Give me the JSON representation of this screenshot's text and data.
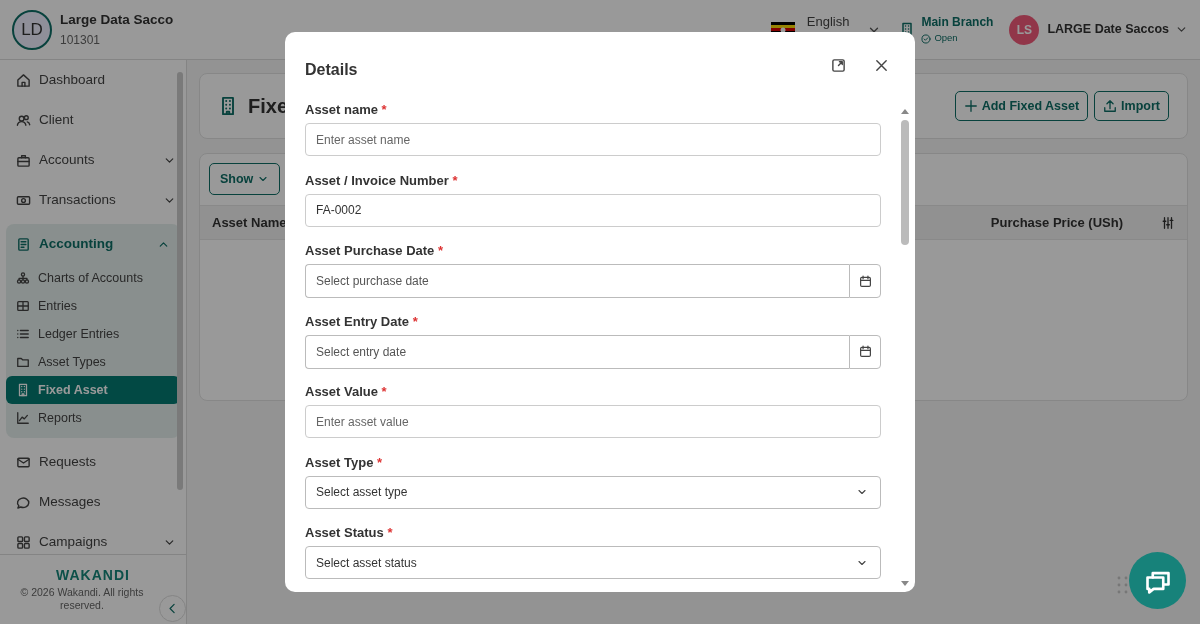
{
  "header": {
    "org": {
      "initials": "LD",
      "name": "Large Data Sacco",
      "code": "101301"
    },
    "language": "English",
    "branch": {
      "name": "Main Branch",
      "status": "Open"
    },
    "user": {
      "initials": "LS",
      "name": "LARGE Date Saccos"
    }
  },
  "sidebar": {
    "items": [
      {
        "label": "Dashboard",
        "selected": false
      },
      {
        "label": "Client",
        "selected": false
      },
      {
        "label": "Accounts",
        "selected": false,
        "expanded": false
      },
      {
        "label": "Transactions",
        "selected": false,
        "expanded": false
      },
      {
        "label": "Accounting",
        "selected": true,
        "expanded": true,
        "children": [
          {
            "label": "Charts of Accounts",
            "selected": false
          },
          {
            "label": "Entries",
            "selected": false
          },
          {
            "label": "Ledger Entries",
            "selected": false
          },
          {
            "label": "Asset Types",
            "selected": false
          },
          {
            "label": "Fixed Asset",
            "selected": true
          },
          {
            "label": "Reports",
            "selected": false
          }
        ]
      },
      {
        "label": "Requests",
        "selected": false
      },
      {
        "label": "Messages",
        "selected": false
      },
      {
        "label": "Campaigns",
        "selected": false,
        "expanded": false
      }
    ],
    "brand": "WAKANDI",
    "copyright": "© 2026 Wakandi. All rights reserved."
  },
  "page": {
    "title": "Fixe",
    "buttons": [
      "Add Fixed Asset",
      "Import"
    ],
    "show_button": "Show",
    "table": {
      "columns": [
        "Asset Name",
        "Purchase Price (USh)"
      ]
    }
  },
  "modal": {
    "title": "Details",
    "fields": [
      {
        "label": "Asset name",
        "required_mark": "*",
        "kind": "text",
        "placeholder": "Enter asset name"
      },
      {
        "label": "Asset / Invoice Number",
        "required_mark": "*",
        "kind": "text",
        "value": "FA-0002"
      },
      {
        "label": "Asset Purchase Date",
        "required_mark": "*",
        "kind": "date",
        "placeholder": "Select purchase date"
      },
      {
        "label": "Asset Entry Date",
        "required_mark": "*",
        "kind": "date",
        "placeholder": "Select entry date"
      },
      {
        "label": "Asset Value",
        "required_mark": "*",
        "kind": "text",
        "placeholder": "Enter asset value"
      },
      {
        "label": "Asset Type",
        "required_mark": "*",
        "kind": "select",
        "placeholder": "Select asset type"
      },
      {
        "label": "Asset Status",
        "required_mark": "*",
        "kind": "select",
        "placeholder": "Select asset status"
      }
    ]
  }
}
